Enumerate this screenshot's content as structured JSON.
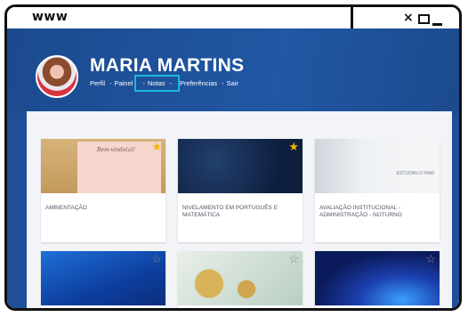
{
  "window": {
    "url_label": "www",
    "close_label": "×"
  },
  "user": {
    "name": "MARIA MARTINS"
  },
  "nav": {
    "items": [
      "Perfil",
      "Painel",
      "Notas",
      "Preferências",
      "Sair"
    ],
    "separator": "-"
  },
  "courses": [
    {
      "title": "AMBIENTAÇÃO",
      "starred": true,
      "image_text": "Bem-vindo(a)!"
    },
    {
      "title": "NIVELAMENTO EM PORTUGUÊS E MATEMÁTICA",
      "starred": true
    },
    {
      "title": "AVALIAÇÃO INSTITUCIONAL - ADMINISTRAÇÃO - NOTURNO",
      "starred": false,
      "image_text": "ESTUDAN O PAIO"
    },
    {
      "title": "",
      "starred": false
    },
    {
      "title": "",
      "starred": false
    },
    {
      "title": "",
      "starred": false
    }
  ],
  "icons": {
    "star_filled": "★",
    "star_outline": "☆"
  },
  "colors": {
    "header_bg": "#1e4f97",
    "highlight": "#1bb7e6",
    "star": "#f5b400"
  }
}
